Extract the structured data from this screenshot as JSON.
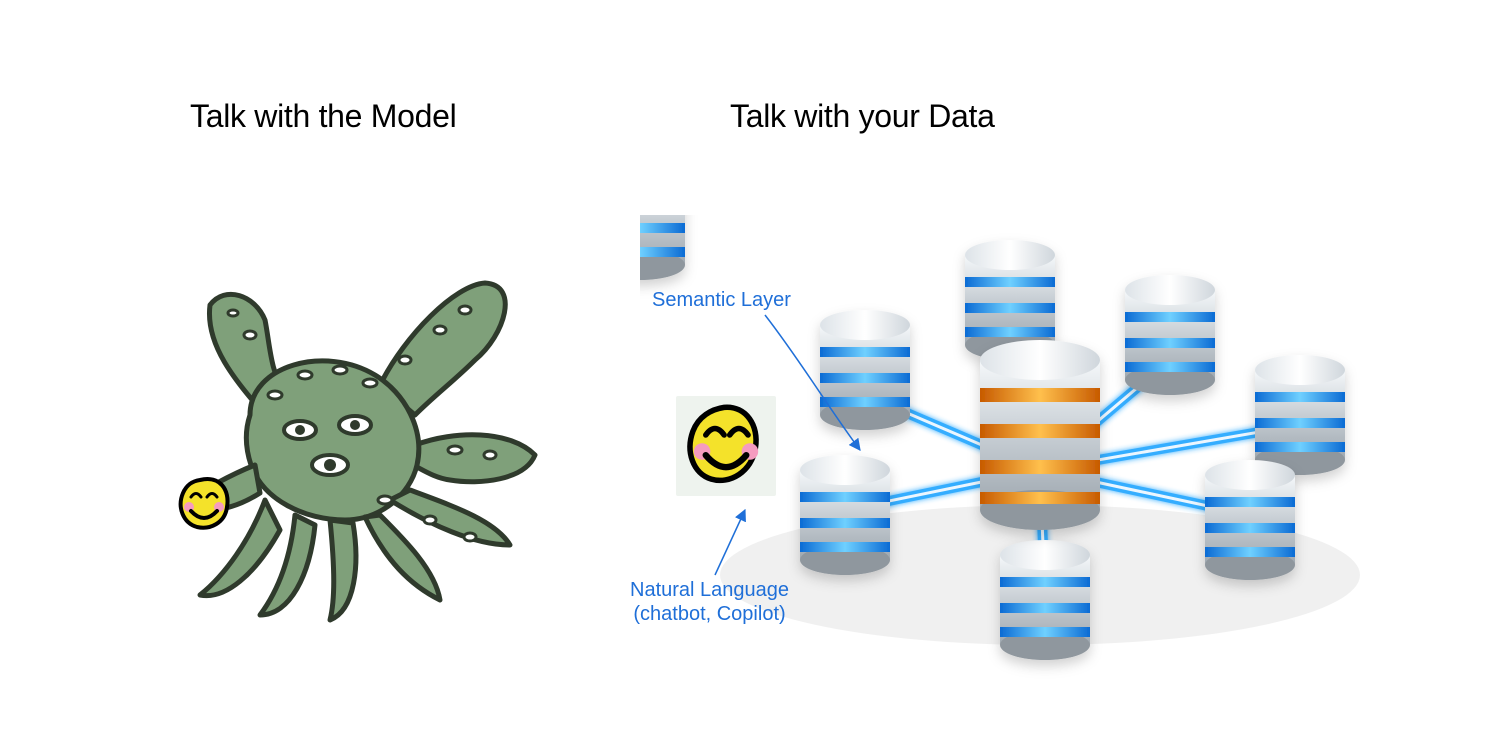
{
  "headings": {
    "left": "Talk with the Model",
    "right": "Talk with your Data"
  },
  "annotations": {
    "semantic_layer": "Semantic Layer",
    "natural_language_line1": "Natural Language",
    "natural_language_line2": "(chatbot, Copilot)"
  },
  "colors": {
    "text": "#000000",
    "annotation": "#1f6fd8",
    "db_silver_light": "#e9edf0",
    "db_silver_dark": "#9ea7af",
    "db_blue_glow": "#2aa9ff",
    "db_orange_glow": "#ff8a00",
    "shoggoth_body": "#7fa07a",
    "shoggoth_outline": "#2f3a2c",
    "mask_yellow": "#f4e22a",
    "mask_pink": "#f59bbf"
  },
  "icons": {
    "shoggoth": "shoggoth-creature",
    "smiley_mask": "smiley-mask",
    "database": "database-cylinder",
    "arrow": "thin-arrow"
  },
  "diagram": {
    "left_panel": "A green tentacled shoggoth creature holding a small smiling yellow mask.",
    "right_panel": "A central large database hub connected by glowing blue links to six smaller database cylinders; a smiley mask labeled as the natural-language / semantic layer points at the hub."
  }
}
